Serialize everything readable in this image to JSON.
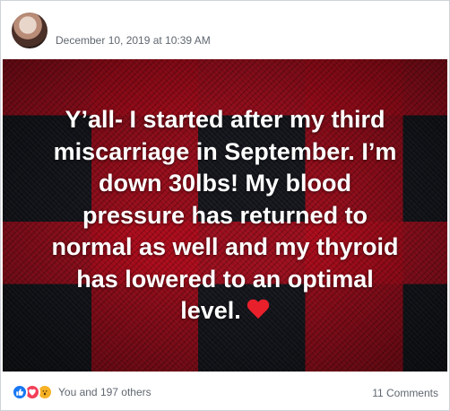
{
  "post": {
    "timestamp": "December 10, 2019 at 10:39 AM",
    "caption_lines": [
      "Y’all- I started after my third",
      "miscarriage in September. I’m",
      "down 30lbs! My blood",
      "pressure has returned to",
      "normal as well and my thyroid",
      "has lowered to an optimal",
      "level."
    ],
    "caption_emoji": "red-heart-emoji"
  },
  "footer": {
    "reaction_icons": [
      "like-icon",
      "love-icon",
      "wow-icon"
    ],
    "reaction_text": "You and 197 others",
    "comments_text": "11 Comments"
  },
  "colors": {
    "like": "#1877f2",
    "love": "#f33e58",
    "wow": "#f7b125",
    "heart": "#e8202c",
    "meta_text": "#606770"
  }
}
